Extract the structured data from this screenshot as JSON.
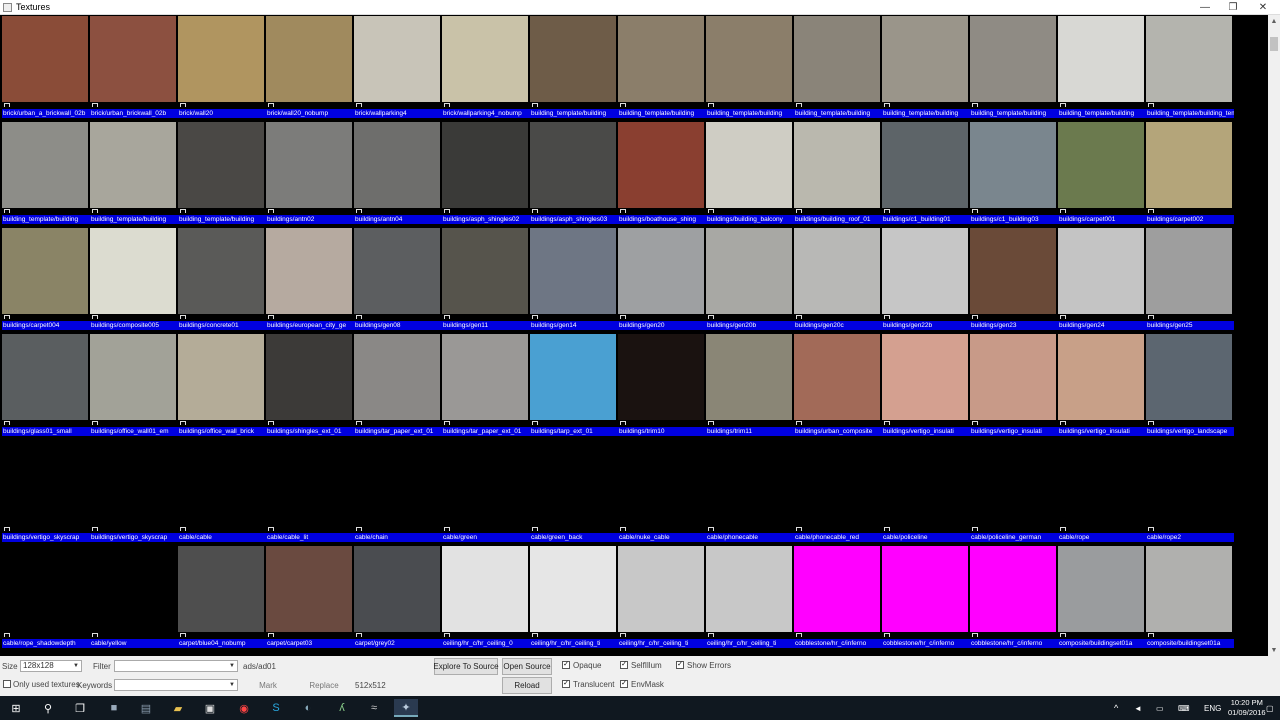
{
  "window": {
    "title": "Textures"
  },
  "colors": {
    "label_bg": "#0000e0",
    "panel_bg": "#f0f0f0",
    "taskbar_bg": "#101820"
  },
  "rows": [
    {
      "labels": [
        "brick/urban_a_brickwall_02b",
        "brick/urban_brickwall_02b",
        "brick/wall20",
        "brick/wall20_nobump",
        "brick/wallparking4",
        "brick/wallparking4_nobump",
        "building_template/building",
        "building_template/building",
        "building_template/building",
        "building_template/building",
        "building_template/building",
        "building_template/building",
        "building_template/building",
        "building_template/building_template"
      ],
      "fills": [
        "#8a4c38",
        "#8c5040",
        "#b09560",
        "#a08a5e",
        "#c8c4b8",
        "#c9c2a8",
        "#6e5c48",
        "#8b7e6a",
        "#8b7e6a",
        "#8a8479",
        "#9a958a",
        "#8f8b84",
        "#d8d8d4",
        "#b4b4ae"
      ]
    },
    {
      "labels": [
        "building_template/building",
        "building_template/building",
        "building_template/building",
        "buildings/antn02",
        "buildings/antn04",
        "buildings/asph_shingles02",
        "buildings/asph_shingles03",
        "buildings/boathouse_shing",
        "buildings/building_balcony",
        "buildings/building_roof_01",
        "buildings/c1_building01",
        "buildings/c1_building03",
        "buildings/carpet001",
        "buildings/carpet002"
      ],
      "fills": [
        "#8d8d88",
        "#a8a69c",
        "#4a4845",
        "#7c7c7a",
        "#6e6e6c",
        "#3a3a38",
        "#4a4a48",
        "#8a3f30",
        "#cfcdc4",
        "#bab8ae",
        "#5d6468",
        "#7a868e",
        "#6b7a4e",
        "#b4a57a"
      ]
    },
    {
      "labels": [
        "buildings/carpet004",
        "buildings/composite005",
        "buildings/concrete01",
        "buildings/european_city_ge",
        "buildings/gen08",
        "buildings/gen11",
        "buildings/gen14",
        "buildings/gen20",
        "buildings/gen20b",
        "buildings/gen20c",
        "buildings/gen22b",
        "buildings/gen23",
        "buildings/gen24",
        "buildings/gen25"
      ],
      "fills": [
        "#8a8466",
        "#dcdcd0",
        "#5a5a58",
        "#b6aaa0",
        "#5c5e60",
        "#56544c",
        "#6e7684",
        "#9ea0a2",
        "#a8a8a4",
        "#b8b8b6",
        "#c6c6c6",
        "#6a4a38",
        "#c4c4c4",
        "#9e9e9e"
      ]
    },
    {
      "labels": [
        "buildings/glass01_small",
        "buildings/office_wall01_em",
        "buildings/office_wall_brick",
        "buildings/shingles_ext_01",
        "buildings/tar_paper_ext_01",
        "buildings/tar_paper_ext_01",
        "buildings/tarp_ext_01",
        "buildings/trim10",
        "buildings/trim11",
        "buildings/urban_composite",
        "buildings/vertigo_insulati",
        "buildings/vertigo_insulati",
        "buildings/vertigo_insulati",
        "buildings/vertigo_landscape"
      ],
      "fills": [
        "#5a5e60",
        "#a2a298",
        "#b4ac98",
        "#3c3a38",
        "#8a8886",
        "#9a9896",
        "#4aa0d2",
        "#1a1210",
        "#8a8676",
        "#a26a58",
        "#d4a090",
        "#c89a88",
        "#c8a088",
        "#5c6670"
      ]
    },
    {
      "labels": [
        "buildings/vertigo_skyscrap",
        "buildings/vertigo_skyscrap",
        "cable/cable",
        "cable/cable_lit",
        "cable/chain",
        "cable/green",
        "cable/green_back",
        "cable/nuke_cable",
        "cable/phonecable",
        "cable/phonecable_red",
        "cable/policeline",
        "cable/policeline_german",
        "cable/rope",
        "cable/rope2"
      ],
      "fills": [
        "#000000",
        "#000000",
        "#000000",
        "#000000",
        "#000000",
        "#000000",
        "#000000",
        "#000000",
        "#000000",
        "#000000",
        "#000000",
        "#000000",
        "#000000",
        "#000000"
      ]
    },
    {
      "labels": [
        "cable/rope_shadowdepth",
        "cable/yellow",
        "carpet/blue04_nobump",
        "carpet/carpet03",
        "carpet/grey02",
        "ceiling/hr_c/hr_ceiling_0",
        "ceiling/hr_c/hr_ceiling_ti",
        "ceiling/hr_c/hr_ceiling_ti",
        "ceiling/hr_c/hr_ceiling_ti",
        "cobblestone/hr_c/inferno",
        "cobblestone/hr_c/inferno",
        "cobblestone/hr_c/inferno",
        "composite/buildingset01a",
        "composite/buildingset01a"
      ],
      "fills": [
        "#000000",
        "#000000",
        "#4e4e4e",
        "#6a4a40",
        "#4a4c50",
        "#e2e2e2",
        "#e6e6e6",
        "#c8c8c8",
        "#c8c8c8",
        "#ff00ff",
        "#ff00ff",
        "#ff00ff",
        "#9a9c9e",
        "#b0b0ae"
      ]
    }
  ],
  "panel": {
    "size_label": "Size",
    "size_value": "128x128",
    "filter_label": "Filter",
    "filter_value": "",
    "path_text": "ads/ad01",
    "explore_button": "Explore To Source",
    "open_button": "Open Source",
    "reload_button": "Reload",
    "opaque_label": "Opaque",
    "selfillum_label": "SelfIllum",
    "show_errors_label": "Show Errors",
    "translucent_label": "Translucent",
    "envmask_label": "EnvMask",
    "only_used_label": "Only used textures",
    "keywords_label": "Keywords",
    "keywords_value": "",
    "mark_button": "Mark",
    "replace_button": "Replace",
    "dims_text": "512x512"
  },
  "taskbar": {
    "lang": "ENG",
    "time": "10:20 PM",
    "date": "01/09/2016"
  }
}
